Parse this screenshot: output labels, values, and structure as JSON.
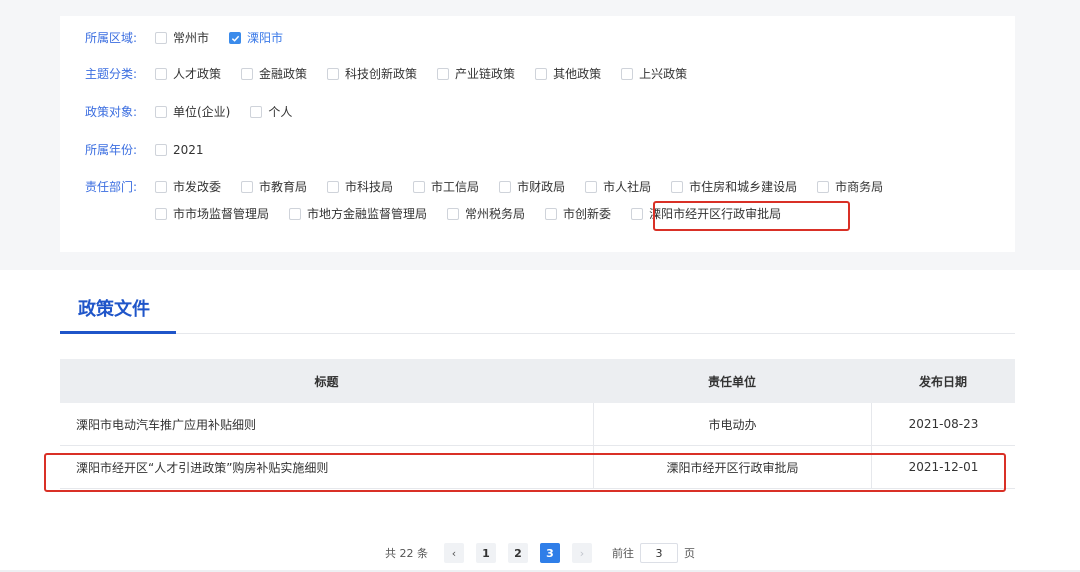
{
  "filters": {
    "region": {
      "label": "所属区域:",
      "options": [
        {
          "text": "常州市",
          "checked": false
        },
        {
          "text": "溧阳市",
          "checked": true
        }
      ]
    },
    "topic": {
      "label": "主题分类:",
      "options": [
        {
          "text": "人才政策"
        },
        {
          "text": "金融政策"
        },
        {
          "text": "科技创新政策"
        },
        {
          "text": "产业链政策"
        },
        {
          "text": "其他政策"
        },
        {
          "text": "上兴政策"
        }
      ]
    },
    "target": {
      "label": "政策对象:",
      "options": [
        {
          "text": "单位(企业)"
        },
        {
          "text": "个人"
        }
      ]
    },
    "year": {
      "label": "所属年份:",
      "options": [
        {
          "text": "2021"
        }
      ]
    },
    "dept": {
      "label": "责任部门:",
      "options": [
        {
          "text": "市发改委"
        },
        {
          "text": "市教育局"
        },
        {
          "text": "市科技局"
        },
        {
          "text": "市工信局"
        },
        {
          "text": "市财政局"
        },
        {
          "text": "市人社局"
        },
        {
          "text": "市住房和城乡建设局"
        },
        {
          "text": "市商务局"
        },
        {
          "text": "市市场监督管理局"
        },
        {
          "text": "市地方金融监督管理局"
        },
        {
          "text": "常州税务局"
        },
        {
          "text": "市创新委"
        },
        {
          "text": "溧阳市经开区行政审批局"
        }
      ]
    }
  },
  "section": {
    "title": "政策文件"
  },
  "table": {
    "headers": {
      "title": "标题",
      "unit": "责任单位",
      "date": "发布日期"
    },
    "rows": [
      {
        "title": "溧阳市电动汽车推广应用补贴细则",
        "unit": "市电动办",
        "date": "2021-08-23"
      },
      {
        "title": "溧阳市经开区“人才引进政策”购房补贴实施细则",
        "unit": "溧阳市经开区行政审批局",
        "date": "2021-12-01"
      }
    ]
  },
  "pager": {
    "total": "共 22 条",
    "prev": "‹",
    "next": "›",
    "pages": [
      "1",
      "2",
      "3"
    ],
    "current": "3",
    "goto_prefix": "前往",
    "goto_value": "3",
    "goto_suffix": "页"
  },
  "colors": {
    "accent": "#1f55c9",
    "highlight": "#d93026",
    "active_page": "#2f7ee8"
  }
}
